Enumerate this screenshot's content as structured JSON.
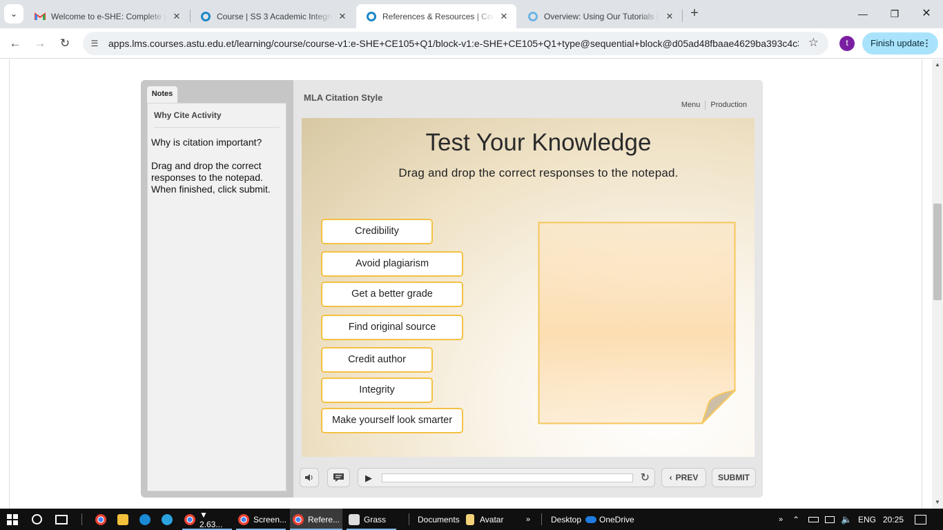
{
  "browser": {
    "tabs": [
      {
        "title": "Welcome to e-SHE: Complete y",
        "icon": "gmail-icon",
        "active": false
      },
      {
        "title": "Course | SS 3 Academic Integrit",
        "icon": "openedx-icon",
        "active": false
      },
      {
        "title": "References & Resources | Concl",
        "icon": "openedx-icon",
        "active": true
      },
      {
        "title": "Overview: Using Our Tutorials |",
        "icon": "openedx-icon",
        "active": false
      }
    ],
    "url": "apps.lms.courses.astu.edu.et/learning/course/course-v1:e-SHE+CE105+Q1/block-v1:e-SHE+CE105+Q1+type@sequential+block@d05ad48fbaae4629ba393c4c3...",
    "profile_initial": "t",
    "update_label": "Finish update"
  },
  "player": {
    "notes_tab": "Notes",
    "notes_heading": "Why Cite Activity",
    "notes_text": "Why is citation important?\n\nDrag and drop the correct responses to the notepad. When finished, click submit.",
    "course_title": "MLA Citation Style",
    "menu_label": "Menu",
    "production_label": "Production",
    "slide_title": "Test Your Knowledge",
    "slide_subtitle": "Drag and drop the correct responses to the notepad.",
    "options": [
      "Credibility",
      "Avoid plagiarism",
      "Get a better grade",
      "Find original source",
      "Credit author",
      "Integrity",
      "Make yourself look smarter"
    ],
    "prev_label": "PREV",
    "submit_label": "SUBMIT"
  },
  "taskbar": {
    "items": [
      "▼ 2.63...",
      "Screen...",
      "Refere...",
      "Grass",
      "Documents",
      "Avatar",
      "Desktop",
      "OneDrive"
    ],
    "language": "ENG",
    "time": "20:25"
  },
  "colors": {
    "chip_border": "#f3c144",
    "notepad_border": "#f5c65a",
    "update_button": "#a9e3fb",
    "profile": "#7b1fa2"
  }
}
